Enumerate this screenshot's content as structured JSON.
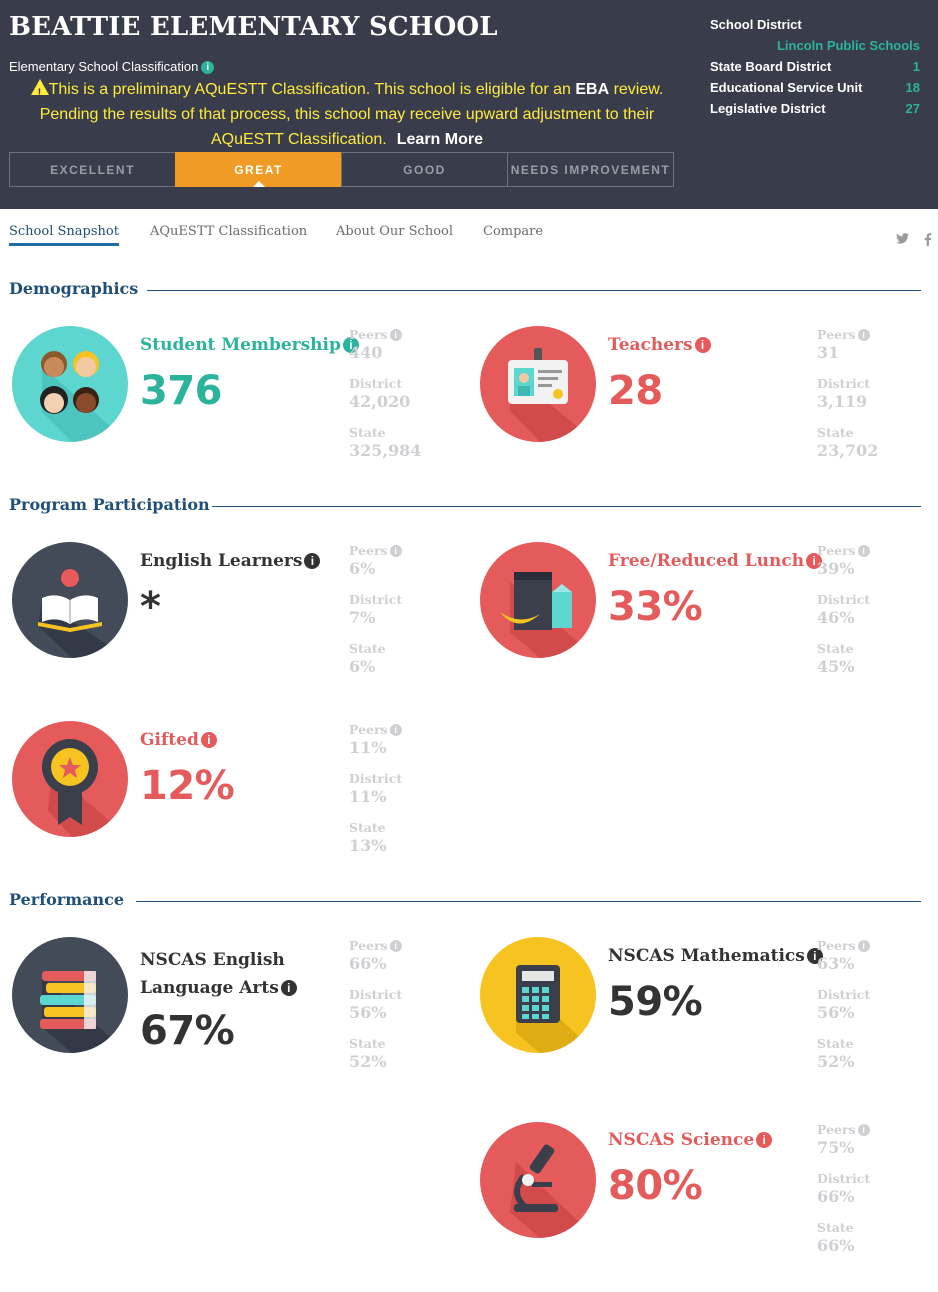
{
  "header": {
    "school_name": "BEATTIE ELEMENTARY SCHOOL",
    "classification_label": "Elementary School Classification",
    "info_icon_glyph": "i",
    "notice_part1": "This is a preliminary AQuESTT Classification. This school is eligible for an ",
    "notice_bold": "EBA",
    "notice_part2": " review. Pending the results of that process, this school may receive upward adjustment to their AQuESTT Classification.",
    "learn_more": "Learn More",
    "tiers": [
      "EXCELLENT",
      "GREAT",
      "GOOD",
      "NEEDS IMPROVEMENT"
    ],
    "active_tier": "GREAT",
    "district": {
      "school_district_label": "School District",
      "school_district_value": "Lincoln Public Schools",
      "state_board_label": "State Board District",
      "state_board_value": "1",
      "esu_label": "Educational Service Unit",
      "esu_value": "18",
      "legislative_label": "Legislative District",
      "legislative_value": "27"
    }
  },
  "nav": {
    "tabs": [
      "School Snapshot",
      "AQuESTT Classification",
      "About Our School",
      "Compare"
    ],
    "active_tab": "School Snapshot",
    "social_icons": [
      "twitter-icon",
      "facebook-icon"
    ]
  },
  "sections": {
    "demographics": "Demographics",
    "program": "Program Participation",
    "performance": "Performance"
  },
  "compare_labels": {
    "peers": "Peers",
    "district": "District",
    "state": "State"
  },
  "metrics": {
    "student_membership": {
      "label": "Student Membership",
      "value": "376",
      "peers": "440",
      "district": "42,020",
      "state": "325,984",
      "icon": "students-icon"
    },
    "teachers": {
      "label": "Teachers",
      "value": "28",
      "peers": "31",
      "district": "3,119",
      "state": "23,702",
      "icon": "id-badge-icon"
    },
    "english_learners": {
      "label": "English Learners",
      "value": "*",
      "peers": "6%",
      "district": "7%",
      "state": "6%",
      "icon": "reader-icon"
    },
    "free_reduced_lunch": {
      "label": "Free/Reduced Lunch",
      "value": "33%",
      "peers": "39%",
      "district": "46%",
      "state": "45%",
      "icon": "lunch-icon"
    },
    "gifted": {
      "label": "Gifted",
      "value": "12%",
      "peers": "11%",
      "district": "11%",
      "state": "13%",
      "icon": "award-ribbon-icon"
    },
    "nscas_ela": {
      "label_line1": "NSCAS English",
      "label_line2": "Language Arts",
      "value": "67%",
      "peers": "66%",
      "district": "56%",
      "state": "52%",
      "icon": "books-icon"
    },
    "nscas_math": {
      "label": "NSCAS Mathematics",
      "value": "59%",
      "peers": "63%",
      "district": "56%",
      "state": "52%",
      "icon": "calculator-icon"
    },
    "nscas_science": {
      "label": "NSCAS Science",
      "value": "80%",
      "peers": "75%",
      "district": "66%",
      "state": "66%",
      "icon": "microscope-icon"
    }
  },
  "colors": {
    "header_bg": "#383c4b",
    "accent_teal": "#2bb39b",
    "accent_red": "#e55b5b",
    "accent_orange": "#ef9b25",
    "accent_yellow": "#f6c320",
    "notice_yellow": "#ffeb3b",
    "section_blue": "#1f4f7a",
    "muted_gray": "#cfd0d3"
  }
}
